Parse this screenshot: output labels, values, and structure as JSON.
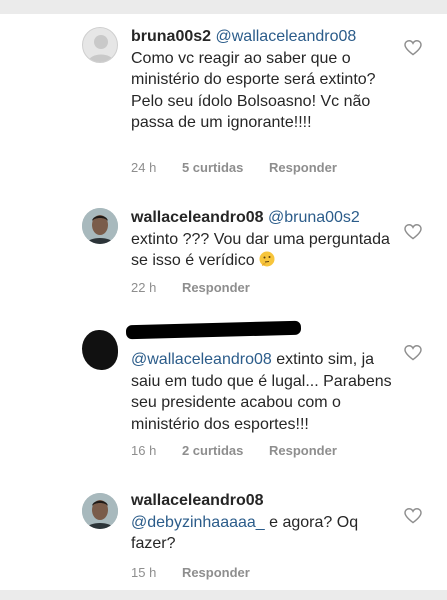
{
  "comments": [
    {
      "username": "bruna00s2",
      "mention": "@wallaceleandro08",
      "text": "Como vc reagir ao saber que o ministério do esporte será extinto? Pelo seu ídolo Bolsoasno! Vc não passa de um ignorante!!!!",
      "time": "24 h",
      "likes": "5 curtidas",
      "reply": "Responder",
      "avatar_icon": "default-profile-avatar"
    },
    {
      "username": "wallaceleandro08",
      "mention": "@bruna00s2",
      "text": "extinto ??? Vou dar uma perguntada se isso é verídico",
      "emoji": "thinking-face-emoji",
      "time": "22 h",
      "reply": "Responder",
      "avatar_icon": "profile-photo-avatar"
    },
    {
      "username": "",
      "mention": "@wallaceleandro08",
      "text": "extinto sim, ja saiu em tudo que é lugal... Parabens seu presidente acabou com o ministério dos esportes!!!",
      "time": "16 h",
      "likes": "2 curtidas",
      "reply": "Responder",
      "avatar_icon": "censored-avatar"
    },
    {
      "username": "wallaceleandro08",
      "mention": "@debyzinhaaaaa_",
      "text": "e agora? Oq fazer?",
      "time": "15 h",
      "reply": "Responder",
      "avatar_icon": "profile-photo-avatar"
    }
  ],
  "colors": {
    "mention": "#2b5c8a",
    "meta": "#8e8e8e",
    "text": "#262626"
  }
}
